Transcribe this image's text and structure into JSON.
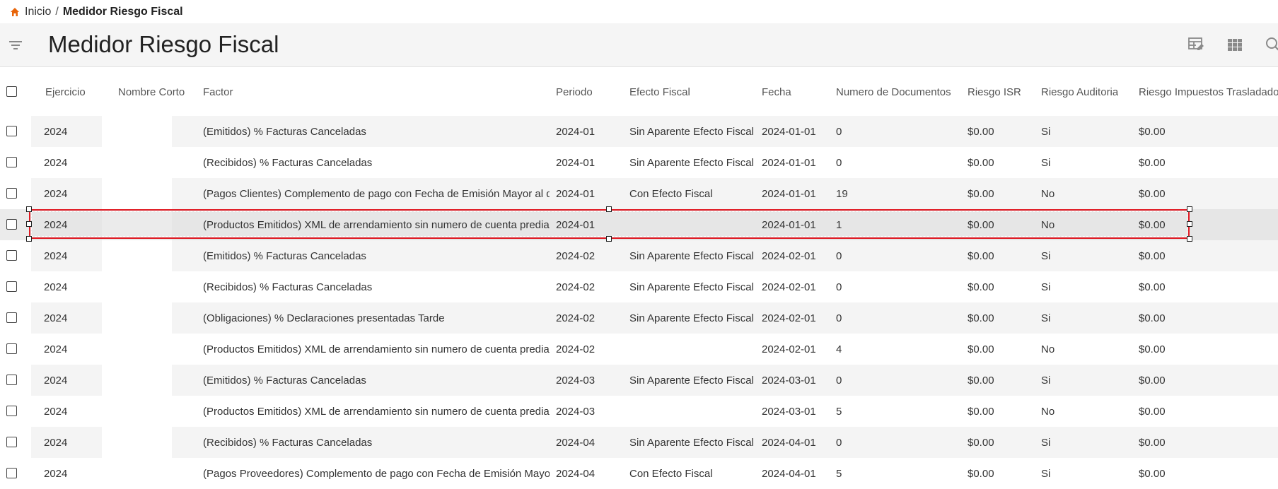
{
  "breadcrumb": {
    "home": "Inicio",
    "separator": "/",
    "current": "Medidor Riesgo Fiscal"
  },
  "header": {
    "title": "Medidor Riesgo Fiscal"
  },
  "columns": [
    "Ejercicio",
    "Nombre Corto",
    "Factor",
    "Periodo",
    "Efecto Fiscal",
    "Fecha",
    "Numero de Documentos",
    "Riesgo ISR",
    "Riesgo Auditoria",
    "Riesgo Impuestos Trasladados"
  ],
  "rows": [
    {
      "ejercicio": "2024",
      "nombre_corto": "",
      "factor": "(Emitidos) % Facturas Canceladas",
      "periodo": "2024-01",
      "efecto": "Sin Aparente Efecto Fiscal",
      "fecha": "2024-01-01",
      "num_docs": "0",
      "riesgo_isr": "$0.00",
      "riesgo_auditoria": "Si",
      "riesgo_imp": "$0.00"
    },
    {
      "ejercicio": "2024",
      "nombre_corto": "",
      "factor": "(Recibidos) % Facturas Canceladas",
      "periodo": "2024-01",
      "efecto": "Sin Aparente Efecto Fiscal",
      "fecha": "2024-01-01",
      "num_docs": "0",
      "riesgo_isr": "$0.00",
      "riesgo_auditoria": "Si",
      "riesgo_imp": "$0.00"
    },
    {
      "ejercicio": "2024",
      "nombre_corto": "",
      "factor": "(Pagos Clientes) Complemento de pago con Fecha de Emisión Mayor al dí...",
      "periodo": "2024-01",
      "efecto": "Con Efecto Fiscal",
      "fecha": "2024-01-01",
      "num_docs": "19",
      "riesgo_isr": "$0.00",
      "riesgo_auditoria": "No",
      "riesgo_imp": "$0.00"
    },
    {
      "ejercicio": "2024",
      "nombre_corto": "",
      "factor": "(Productos Emitidos) XML de arrendamiento sin numero de cuenta predial",
      "periodo": "2024-01",
      "efecto": "",
      "fecha": "2024-01-01",
      "num_docs": "1",
      "riesgo_isr": "$0.00",
      "riesgo_auditoria": "No",
      "riesgo_imp": "$0.00"
    },
    {
      "ejercicio": "2024",
      "nombre_corto": "",
      "factor": "(Emitidos) % Facturas Canceladas",
      "periodo": "2024-02",
      "efecto": "Sin Aparente Efecto Fiscal",
      "fecha": "2024-02-01",
      "num_docs": "0",
      "riesgo_isr": "$0.00",
      "riesgo_auditoria": "Si",
      "riesgo_imp": "$0.00"
    },
    {
      "ejercicio": "2024",
      "nombre_corto": "",
      "factor": "(Recibidos) % Facturas Canceladas",
      "periodo": "2024-02",
      "efecto": "Sin Aparente Efecto Fiscal",
      "fecha": "2024-02-01",
      "num_docs": "0",
      "riesgo_isr": "$0.00",
      "riesgo_auditoria": "Si",
      "riesgo_imp": "$0.00"
    },
    {
      "ejercicio": "2024",
      "nombre_corto": "",
      "factor": "(Obligaciones) % Declaraciones presentadas Tarde",
      "periodo": "2024-02",
      "efecto": "Sin Aparente Efecto Fiscal",
      "fecha": "2024-02-01",
      "num_docs": "0",
      "riesgo_isr": "$0.00",
      "riesgo_auditoria": "Si",
      "riesgo_imp": "$0.00"
    },
    {
      "ejercicio": "2024",
      "nombre_corto": "",
      "factor": "(Productos Emitidos) XML de arrendamiento sin numero de cuenta predial",
      "periodo": "2024-02",
      "efecto": "",
      "fecha": "2024-02-01",
      "num_docs": "4",
      "riesgo_isr": "$0.00",
      "riesgo_auditoria": "No",
      "riesgo_imp": "$0.00"
    },
    {
      "ejercicio": "2024",
      "nombre_corto": "",
      "factor": "(Emitidos) % Facturas Canceladas",
      "periodo": "2024-03",
      "efecto": "Sin Aparente Efecto Fiscal",
      "fecha": "2024-03-01",
      "num_docs": "0",
      "riesgo_isr": "$0.00",
      "riesgo_auditoria": "Si",
      "riesgo_imp": "$0.00"
    },
    {
      "ejercicio": "2024",
      "nombre_corto": "",
      "factor": "(Productos Emitidos) XML de arrendamiento sin numero de cuenta predial",
      "periodo": "2024-03",
      "efecto": "",
      "fecha": "2024-03-01",
      "num_docs": "5",
      "riesgo_isr": "$0.00",
      "riesgo_auditoria": "No",
      "riesgo_imp": "$0.00"
    },
    {
      "ejercicio": "2024",
      "nombre_corto": "",
      "factor": "(Recibidos) % Facturas Canceladas",
      "periodo": "2024-04",
      "efecto": "Sin Aparente Efecto Fiscal",
      "fecha": "2024-04-01",
      "num_docs": "0",
      "riesgo_isr": "$0.00",
      "riesgo_auditoria": "Si",
      "riesgo_imp": "$0.00"
    },
    {
      "ejercicio": "2024",
      "nombre_corto": "",
      "factor": "(Pagos Proveedores) Complemento de pago con Fecha de Emisión Mayor ...",
      "periodo": "2024-04",
      "efecto": "Con Efecto Fiscal",
      "fecha": "2024-04-01",
      "num_docs": "5",
      "riesgo_isr": "$0.00",
      "riesgo_auditoria": "Si",
      "riesgo_imp": "$0.00"
    }
  ],
  "selected_row": 3,
  "colors": {
    "accent": "#e8650a",
    "selection": "#e01b24",
    "stripe": "#f4f4f4",
    "header_bg": "#f5f5f5"
  },
  "icons": [
    "home-icon",
    "filter-icon",
    "edit-table-icon",
    "grid-view-icon",
    "search-icon"
  ]
}
